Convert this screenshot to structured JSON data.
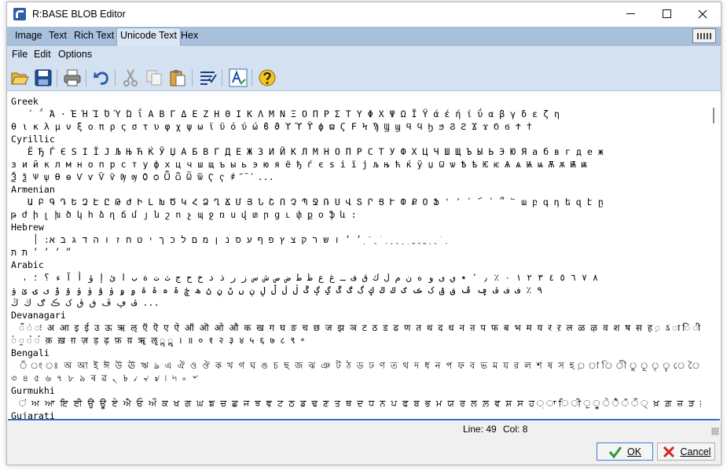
{
  "window": {
    "title": "R:BASE BLOB Editor"
  },
  "tabs": [
    {
      "label": "Image"
    },
    {
      "label": "Text"
    },
    {
      "label": "Rich Text"
    },
    {
      "label": "Unicode Text"
    },
    {
      "label": "Hex"
    }
  ],
  "menu": [
    "File",
    "Edit",
    "Options"
  ],
  "toolbar_icons": [
    "open-folder-icon",
    "save-icon",
    "print-icon",
    "undo-icon",
    "cut-icon",
    "copy-icon",
    "paste-icon",
    "word-wrap-icon",
    "font-icon",
    "help-icon"
  ],
  "editor": {
    "lines": [
      "Greek",
      "   ΄ ΅ Ά · Έ Ή Ί Ό Ύ Ώ ΐ Α Β Γ Δ Ε Ζ Η Θ Ι Κ Λ Μ Ν Ξ Ο Π Ρ Σ Τ Υ Φ Χ Ψ Ω Ϊ Ϋ ά έ ή ί ΰ α β γ δ ε ζ η",
      "θ ι κ λ μ ν ξ ο π ρ ς σ τ υ φ χ ψ ω ϊ ϋ ό ύ ώ ϐ ϑ ϒ ϓ ϔ ϕ ϖ Ϛ Ϝ Ϟ Ϡ Ϣ ϣ Ϥ ϥ Ϧ ϧ Ϩ ϩ Ϫ ϫ Ϭ ϭ Ϯ ϯ",
      "Cyrillic",
      "   Ё Ђ Ѓ Є Ѕ І Ї Ј Љ Њ Ћ Ќ Ў Џ А Б В Г Д Е Ж З И Й К Л М Н О П Р С Т У Ф Х Ц Ч Ш Щ Ъ Ы Ь Э Ю Я а б в г д е ж",
      "з и й к л м н о п р с т у ф х ц ч ш щ ъ ы ь э ю я ё ђ ѓ є ѕ і ї ј љ њ ћ ќ ў џ Ѡ ѡ Ѣ ѣ Ѥ ѥ Ѧ ѧ Ѩ ѩ Ѫ ѫ Ѭ ѭ",
      "Ѯ ѯ Ѱ ѱ Ѳ ѳ Ѵ ѵ Ѷ ѷ Ѹ ѹ Ѻ ѻ Ѽ ѽ Ѿ ѿ Ҁ ҁ ҂ ҃ ҄ ҅ ...",
      "Armenian",
      "   Ա Բ Գ Դ Ե Զ Է Ը Թ Ժ Ի Լ Խ Ծ Կ Հ Ձ Ղ Ճ Մ Յ Ն Շ Ո Չ Պ Ջ Ռ Ս Վ Տ Ր Ց Ւ Փ Ք Օ Ֆ ՙ ՚ ՛ ՜ ՝ ՞ ՟ ա բ գ դ ե զ է ը",
      "թ ժ ի լ խ ծ կ հ ձ ղ ճ մ յ ն շ ո չ պ ջ ռ ս վ տ ր ց ւ փ ք օ ֆ և :",
      "Hebrew",
      "    ׳ ׳ ו ש ר ק צ ץ פ ף ע ס נ ן מ ם ל כ ך י ט ח ז ו ה ד ג ב א ׃ ׀ ֽ ֿ ֻ ֹ ַ ָ ֶ ֵ ִ ֳ ֲ ֱ ְ ֻ ֹ ַ",
      "״ ׳ ׳ ׳ ת ת",
      "Arabic",
      "  ، ٨ ٧ ٦ ٥ ٤ ٣ ٢ ١ ٠ ٪ ٫ ٬ ٭ ي ى و ه ن م ل ك ق ف ـ غ ع ظ ط ض ص ش س ز ر ذ د خ ح ج ث ت ة ب ا ئ إ ؤ أ آ ء ؟ ؛",
      "٩ ٪ ف ف ڤ ڥ ڦ ڧ ڨ ک ڪ ګ ڬ ڭ ڮ گ ڰ ڱ ڲ ڳ ڴ ڵ ڶ ڷ ڸ ڹ ں ڻ ڼ ڽ ھ ڿ ۀ ہ ۂ ۃ ۄ ۅ ۆ ۇ ۈ ۉ ۊ ۋ ی ۍ ێ ۏ",
      "ڤ ڥ ڦ ڧ ڨ ک ڪ ګ ڬ ڭ ...",
      "Devanagari",
      "  ँ ं ः अ आ इ ई उ ऊ ऋ ऌ ऍ ऎ ए ऐ ऑ ऒ ओ औ क ख ग घ ङ च छ ज झ ञ ट ठ ड ढ ण त थ द ध न ऩ प फ ब भ म य र ऱ ल ळ ऴ व श ष स ह ़ ऽ ा ि ी ु ू ृ ॄ ॅ ॆ े ै ॉ ॊ ो ौ ् ॐ",
      "॑ ॒ ॓ ॔ क़ ख़ ग़ ज़ ड़ ढ़ फ़ य़ ॠ ॡ ॢ ॣ । ॥ ० १ २ ३ ४ ५ ६ ७ ८ ९ ॰",
      "Bengali",
      "  ঁ ং ঃ অ আ ই ঈ উ ঊ ঋ ঌ এ ঐ ও ঔ ক খ গ ঘ ঙ চ ছ জ ঝ ঞ ট ঠ ড ঢ ণ ত থ দ ধ ন প ফ ব ভ ম য র ল শ ষ স হ ় া ি ী ু ূ ৃ ৄ ে ৈ ো ৌ ্ ৗ ড় ঢ় য় ৠ ৡ ৢ ৣ ০ ১ ২",
      "৩ ৪ ৫ ৬ ৭ ৮ ৯ ৰ ৱ ৲ ৳ ৴ ৵ ৶ ৷ ৸ ৹ ৺",
      "Gurmukhi",
      "  ਂ ਅ ਆ ਇ ਈ ਉ ਊ ਏ ਐ ਓ ਔ ਕ ਖ ਗ ਘ ਙ ਚ ਛ ਜ ਝ ਞ ਟ ਠ ਡ ਢ ਣ ਤ ਥ ਦ ਧ ਨ ਪ ਫ ਬ ਭ ਮ ਯ ਰ ਲ ਲ਼ ਵ ਸ਼ ਸ ਹ ਼ ਾ ਿ ੀ ੁ ੂ ੇ ੈ ੋ ੌ ੍ ਖ਼ ਗ਼ ਜ਼ ੜ ਫ਼ ੦ ੧ ੨ ੩ ੪ ੫ ੬ ੭ ੮ ੯ ੰ ੱ ੲ ੳ ੴ",
      "Gujarati"
    ]
  },
  "status": {
    "line_label": "Line:",
    "line_value": "49",
    "col_label": "Col:",
    "col_value": "8"
  },
  "buttons": {
    "ok": "OK",
    "cancel": "Cancel"
  }
}
